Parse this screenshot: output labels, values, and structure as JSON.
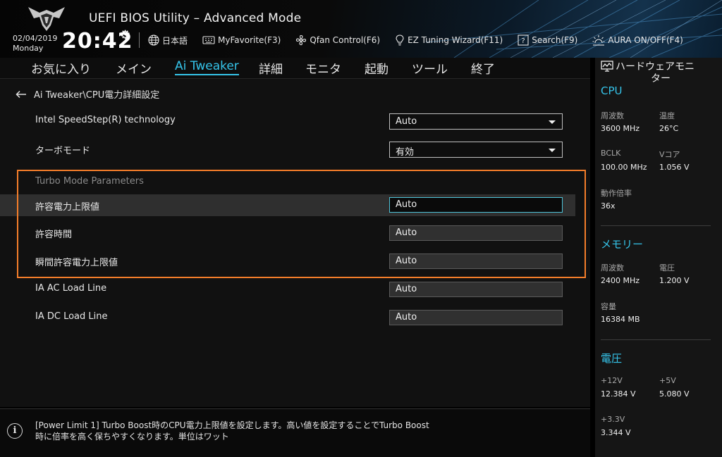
{
  "header": {
    "title": "UEFI BIOS Utility – Advanced Mode",
    "date": "02/04/2019",
    "day": "Monday",
    "time": "20:42",
    "toolbar": [
      {
        "icon": "globe-icon",
        "label": "日本語"
      },
      {
        "icon": "keyboard-icon",
        "label": "MyFavorite(F3)"
      },
      {
        "icon": "fan-icon",
        "label": "Qfan Control(F6)"
      },
      {
        "icon": "lightbulb-icon",
        "label": "EZ Tuning Wizard(F11)"
      },
      {
        "icon": "search-question-icon",
        "label": "Search(F9)"
      },
      {
        "icon": "aura-icon",
        "label": "AURA ON/OFF(F4)"
      }
    ]
  },
  "tabs": [
    {
      "label": "お気に入り"
    },
    {
      "label": "メイン"
    },
    {
      "label": "Ai Tweaker",
      "active": true
    },
    {
      "label": "詳細"
    },
    {
      "label": "モニタ"
    },
    {
      "label": "起動"
    },
    {
      "label": "ツール"
    },
    {
      "label": "終了"
    }
  ],
  "breadcrumb": "Ai Tweaker\\CPU電力詳細設定",
  "settings": {
    "speedstep": {
      "label": "Intel SpeedStep(R) technology",
      "value": "Auto"
    },
    "turbo_mode": {
      "label": "ターボモード",
      "value": "有効"
    },
    "turbo_params_title": "Turbo Mode Parameters",
    "power_limit": {
      "label": "許容電力上限値",
      "value": "Auto"
    },
    "power_time": {
      "label": "許容時間",
      "value": "Auto"
    },
    "short_power_limit": {
      "label": "瞬間許容電力上限値",
      "value": "Auto"
    },
    "ia_ac_loadline": {
      "label": "IA AC Load Line",
      "value": "Auto"
    },
    "ia_dc_loadline": {
      "label": "IA DC Load Line",
      "value": "Auto"
    }
  },
  "help_text": "[Power Limit 1] Turbo Boost時のCPU電力上限値を設定します。高い値を設定することでTurbo Boost時に倍率を高く保ちやすくなります。単位はワット",
  "monitor": {
    "title_line1": "ハードウェアモニ",
    "title_line2": "ター",
    "cpu": {
      "title": "CPU",
      "freq_label": "周波数",
      "freq": "3600 MHz",
      "temp_label": "温度",
      "temp": "26°C",
      "bclk_label": "BCLK",
      "bclk": "100.00 MHz",
      "vcore_label": "Vコア",
      "vcore": "1.056 V",
      "ratio_label": "動作倍率",
      "ratio": "36x"
    },
    "memory": {
      "title": "メモリー",
      "freq_label": "周波数",
      "freq": "2400 MHz",
      "volt_label": "電圧",
      "volt": "1.200 V",
      "cap_label": "容量",
      "cap": "16384 MB"
    },
    "voltage": {
      "title": "電圧",
      "v12_label": "+12V",
      "v12": "12.384 V",
      "v5_label": "+5V",
      "v5": "5.080 V",
      "v33_label": "+3.3V",
      "v33": "3.344 V"
    }
  },
  "colors": {
    "accent": "#35c4ea",
    "highlight_box": "#f47d2a",
    "selected_row": "#2f2f2f"
  }
}
